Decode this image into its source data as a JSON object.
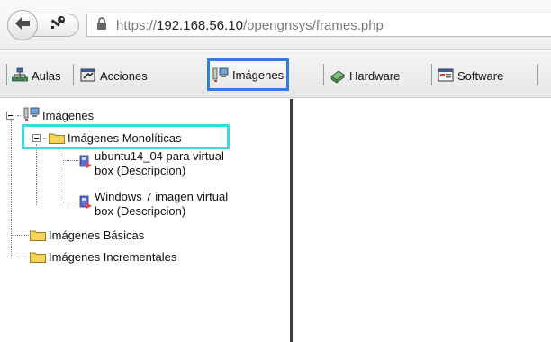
{
  "browser": {
    "url_prefix": "https://",
    "url_host": "192.168.56.10",
    "url_path": "/opengnsys/frames.php"
  },
  "toolbar": {
    "items": [
      {
        "label": "Aulas",
        "icon": "network-icon"
      },
      {
        "label": "Acciones",
        "icon": "actions-icon"
      },
      {
        "label": "Imágenes",
        "icon": "computers-icon",
        "active": true
      },
      {
        "label": "Hardware",
        "icon": "hardware-icon"
      },
      {
        "label": "Software",
        "icon": "software-icon"
      }
    ]
  },
  "tree": {
    "root": {
      "label": "Imágenes",
      "icon": "computers-icon"
    },
    "group_monoliticas": {
      "label": "Imágenes Monolíticas",
      "children": [
        {
          "line1": "ubuntu14_04 para virtual",
          "line2": "box (Descripcion)"
        },
        {
          "line1": "Windows 7 imagen virtual",
          "line2": "box (Descripcion)"
        }
      ]
    },
    "group_basicas": {
      "label": "Imágenes Básicas"
    },
    "group_incrementales": {
      "label": "Imágenes Incrementales"
    }
  },
  "colors": {
    "active_tab_border": "#2a7fe0",
    "tree_highlight": "#33dbe0",
    "folder_yellow": "#f5d35a"
  }
}
